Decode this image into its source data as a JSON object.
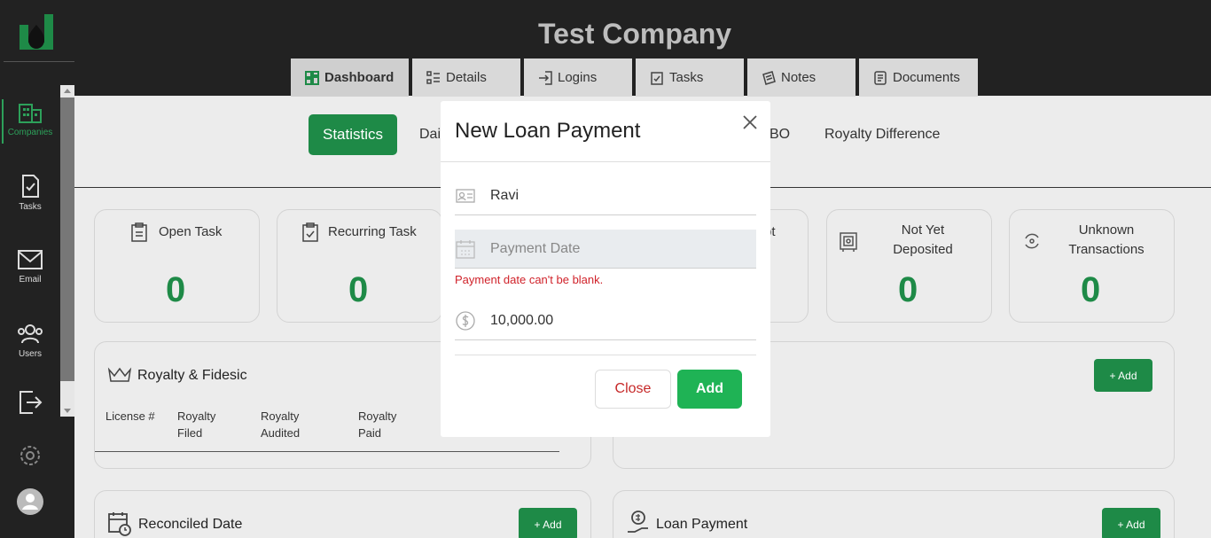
{
  "header": {
    "company": "Test Company"
  },
  "tabs": [
    {
      "label": "Dashboard",
      "icon": "grid-icon"
    },
    {
      "label": "Details",
      "icon": "list-icon"
    },
    {
      "label": "Logins",
      "icon": "login-icon"
    },
    {
      "label": "Tasks",
      "icon": "clipboard-check-icon"
    },
    {
      "label": "Notes",
      "icon": "notes-icon"
    },
    {
      "label": "Documents",
      "icon": "document-icon"
    }
  ],
  "sidebar": {
    "items": [
      {
        "label": "Companies",
        "icon": "building-icon"
      },
      {
        "label": "Tasks",
        "icon": "task-icon"
      },
      {
        "label": "Email",
        "icon": "mail-icon"
      },
      {
        "label": "Users",
        "icon": "users-icon"
      }
    ]
  },
  "subtabs": {
    "statistics": "Statistics",
    "daily_partial": "Dai",
    "bo_partial": "BO",
    "royalty_difference": "Royalty Difference"
  },
  "stats": [
    {
      "title": "Open Task",
      "value": "0"
    },
    {
      "title": "Recurring Task",
      "value": "0"
    },
    {
      "title_partial": "pt"
    },
    {
      "title": "Not Yet Deposited",
      "value": "0"
    },
    {
      "title": "Unknown Transactions",
      "value": "0"
    }
  ],
  "royalty": {
    "title": "Royalty & Fidesic",
    "columns": [
      "License #",
      "Royalty Filed",
      "Royalty Audited",
      "Royalty Paid"
    ]
  },
  "add_label": "+ Add",
  "reconciled": {
    "title": "Reconciled Date"
  },
  "loan_panel": {
    "title": "Loan Payment"
  },
  "modal": {
    "title": "New Loan Payment",
    "name_value": "Ravi",
    "date_placeholder": "Payment Date",
    "error": "Payment date can't be blank.",
    "amount_value": "10,000.00",
    "close_label": "Close",
    "add_label": "Add"
  },
  "colors": {
    "accent": "#1e8a47",
    "add_button": "#1fb355",
    "error": "#d0222a",
    "sidebar": "#222222"
  }
}
